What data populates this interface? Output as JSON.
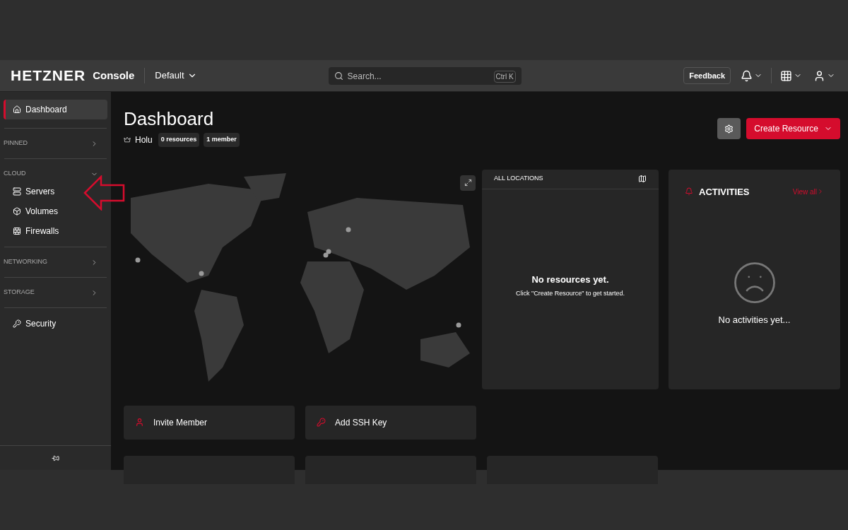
{
  "header": {
    "logo": "HETZNER",
    "product": "Console",
    "project": "Default",
    "search": {
      "placeholder": "Search...",
      "shortcut": "Ctrl K"
    },
    "feedback": "Feedback"
  },
  "sidebar": {
    "items": [
      {
        "kind": "link",
        "label": "Dashboard",
        "selected": true
      },
      {
        "kind": "section",
        "label": "PINNED",
        "expanded": false
      },
      {
        "kind": "section",
        "label": "CLOUD",
        "expanded": true,
        "children": [
          {
            "label": "Servers",
            "selected": false
          },
          {
            "label": "Volumes",
            "selected": false
          },
          {
            "label": "Firewalls",
            "selected": false
          }
        ]
      },
      {
        "kind": "section",
        "label": "NETWORKING",
        "expanded": false
      },
      {
        "kind": "section",
        "label": "STORAGE",
        "expanded": false
      },
      {
        "kind": "link",
        "label": "Security",
        "selected": false
      }
    ]
  },
  "page": {
    "title": "Dashboard",
    "project": "Holu",
    "badges": [
      "0 resources",
      "1 member"
    ],
    "create_button": "Create Resource"
  },
  "locations": {
    "title": "ALL LOCATIONS",
    "empty_title": "No resources yet.",
    "empty_text": "Click \"Create Resource\" to get started."
  },
  "activities": {
    "title": "ACTIVITIES",
    "view_all": "View all",
    "empty_text": "No activities yet..."
  },
  "quick_actions": [
    {
      "label": "Invite Member"
    },
    {
      "label": "Add SSH Key"
    }
  ]
}
